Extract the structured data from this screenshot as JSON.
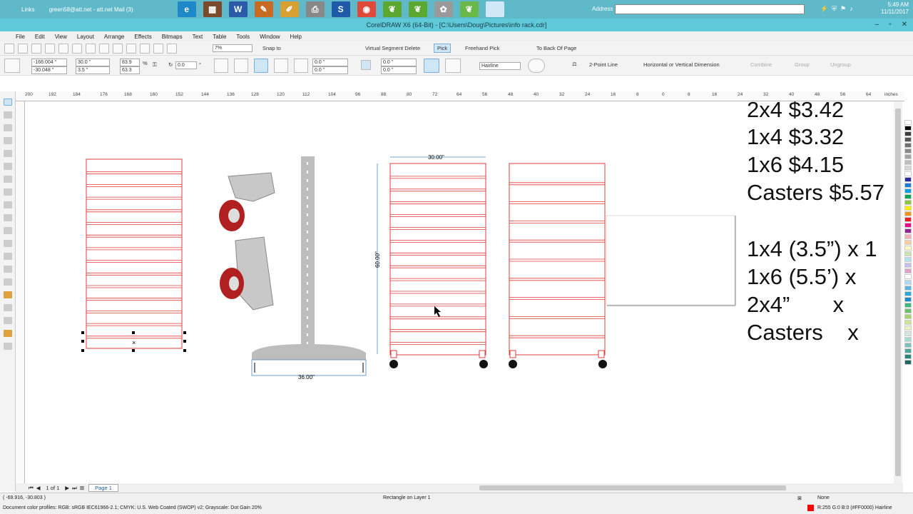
{
  "taskbar": {
    "links": "Links",
    "mail": "green58@att.net - att.net Mail (3)",
    "address_label": "Address",
    "clock_time": "5:49 AM",
    "clock_date": "11/11/2017"
  },
  "window": {
    "title": "CorelDRAW X6 (64-Bit) - [C:\\Users\\Doug\\Pictures\\info rack.cdr]"
  },
  "menu": [
    "File",
    "Edit",
    "View",
    "Layout",
    "Arrange",
    "Effects",
    "Bitmaps",
    "Text",
    "Table",
    "Tools",
    "Window",
    "Help"
  ],
  "toolbar1": {
    "zoom": "7%",
    "snap_to": "Snap to",
    "virtual_segment_delete": "Virtual Segment Delete",
    "pick": "Pick",
    "freehand_pick": "Freehand Pick",
    "to_back_of_page": "To Back Of Page"
  },
  "toolbar2": {
    "x": "-166.004 \"",
    "y": "-30.048 \"",
    "w": "30.0 \"",
    "h": "3.5 \"",
    "sx": "83.9",
    "sy": "63.3",
    "pct": "%",
    "angle": "0.0",
    "deg": "°",
    "pos1": "0.0 \"",
    "pos2": "0.0 \"",
    "pos3": "0.0 \"",
    "pos4": "0.0 \"",
    "outline": "Hairline",
    "two_point_line": "2-Point Line",
    "horiz_vert_dim": "Horizontal or Vertical Dimension",
    "combine": "Combine",
    "group": "Group",
    "ungroup": "Ungroup"
  },
  "ruler": {
    "labels": [
      "200",
      "192",
      "184",
      "176",
      "168",
      "160",
      "152",
      "144",
      "136",
      "128",
      "120",
      "112",
      "104",
      "96",
      "88",
      "80",
      "72",
      "64",
      "56",
      "48",
      "40",
      "32",
      "24",
      "16",
      "8",
      "0",
      "8",
      "16",
      "24",
      "32",
      "40",
      "48",
      "56",
      "64"
    ],
    "unit": "inches"
  },
  "canvas": {
    "prices": [
      "2x4 $3.42",
      "1x4 $3.32",
      "1x6 $4.15",
      "Casters $5.57"
    ],
    "quantities": [
      "1x4 (3.5”) x 1",
      "1x6 (5.5’) x",
      "2x4”       x",
      "Casters    x"
    ],
    "dim_width_top": "30.00\"",
    "dim_height": "60.00\"",
    "dim_base": "36.00\""
  },
  "page_nav": {
    "count": "1 of 1",
    "tab": "Page 1"
  },
  "status": {
    "coords": "( -69.916, -30.803 )",
    "object": "Rectangle on Layer 1",
    "fill": "None",
    "outline": "R:255 G:0 B:0 (#FF0000)  Hairline",
    "profiles": "Document color profiles: RGB: sRGB IEC61966-2.1; CMYK: U.S. Web Coated (SWOP) v2; Grayscale: Dot Gain 20%"
  },
  "colors": {
    "accent": "#5fc9d9",
    "rack_line": "#e23b3b",
    "post": "#bdbdbd",
    "palette": [
      "#ffffff",
      "#000000",
      "#3c3c3c",
      "#555555",
      "#707070",
      "#8a8a8a",
      "#a3a3a3",
      "#bdbdbd",
      "#d6d6d6",
      "#ffffff",
      "#2a2a9e",
      "#1e7ad6",
      "#00a0e9",
      "#00a651",
      "#8dc63f",
      "#fff200",
      "#f7941d",
      "#ed1c24",
      "#ec008c",
      "#92278f",
      "#f7b2b2",
      "#f9d0a0",
      "#fffac2",
      "#c9e6b0",
      "#b4e0f0",
      "#c8c0e8",
      "#e0a0c8",
      "#ffffff",
      "#b0d8f0",
      "#5ab4e0",
      "#2aa8d8",
      "#1e8ac8",
      "#3cb878",
      "#6dc06d",
      "#a3d56c",
      "#cfe59a",
      "#e8f2c8",
      "#cfe8e0",
      "#a8d8d0",
      "#7cc0b8",
      "#4aa898",
      "#2a8878",
      "#1e6a60"
    ]
  }
}
